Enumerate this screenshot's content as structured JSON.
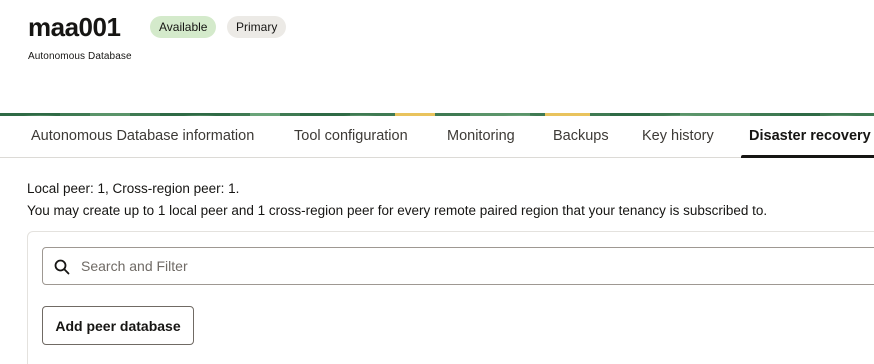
{
  "header": {
    "title": "maa001",
    "subtitle": "Autonomous Database",
    "badges": {
      "status": "Available",
      "role": "Primary"
    }
  },
  "tabs": [
    {
      "label": "Autonomous Database information",
      "active": false
    },
    {
      "label": "Tool configuration",
      "active": false
    },
    {
      "label": "Monitoring",
      "active": false
    },
    {
      "label": "Backups",
      "active": false
    },
    {
      "label": "Key history",
      "active": false
    },
    {
      "label": "Disaster recovery",
      "active": true
    }
  ],
  "disaster_recovery": {
    "peer_counts": "Local peer: 1, Cross-region peer: 1.",
    "limit_note": "You may create up to 1 local peer and 1 cross-region peer for every remote paired region that your tenancy is subscribed to.",
    "search": {
      "placeholder": "Search and Filter",
      "value": "",
      "icon": "search-icon"
    },
    "add_button_label": "Add peer database"
  },
  "colors": {
    "available_badge": "#d4eacb",
    "primary_badge": "#eceae6",
    "banner_green": "#3f7a52",
    "banner_yellow": "#e9c35d",
    "active_tab_underline": "#161513"
  }
}
